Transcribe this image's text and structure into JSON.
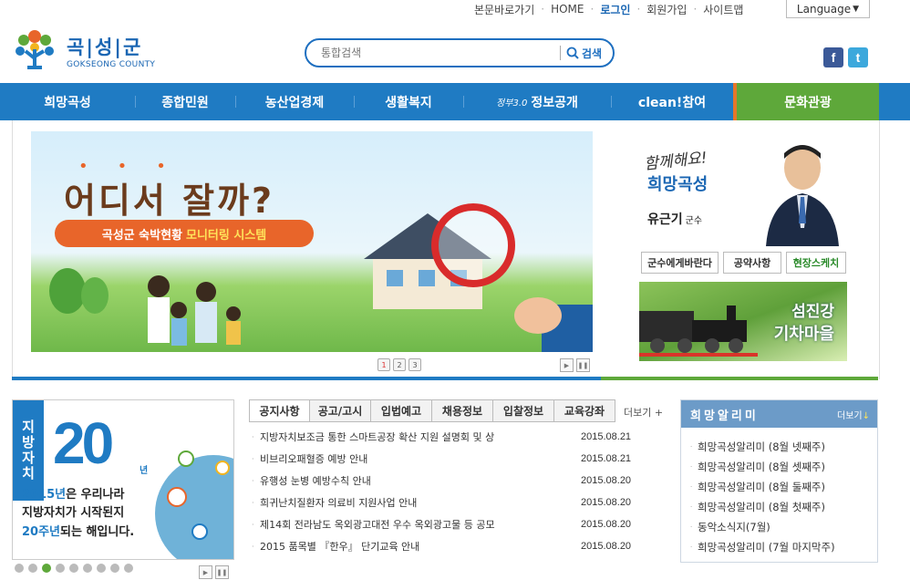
{
  "util": {
    "links": [
      "본문바로가기",
      "HOME",
      "로그인",
      "회원가입",
      "사이트맵"
    ],
    "language": "Language"
  },
  "logo": {
    "name_ko": "곡|성|군",
    "name_en": "GOKSEONG COUNTY"
  },
  "search": {
    "placeholder": "통합검색",
    "button_label": "검색"
  },
  "social": {
    "facebook": "f",
    "twitter": "t"
  },
  "nav": {
    "items": [
      "희망곡성",
      "종합민원",
      "농산업경제",
      "생활복지",
      "정보공개",
      "clean!참여",
      "문화관광"
    ],
    "gov30_prefix": "정부3.0"
  },
  "banner": {
    "headline": "어디서 잘까?",
    "pill_text": "곡성군 숙박현황",
    "pill_accent": "모니터링 시스템",
    "pages": [
      "1",
      "2",
      "3"
    ]
  },
  "governor": {
    "slogan1": "함께해요!",
    "slogan2": "희망곡성",
    "name": "유근기",
    "title": "군수",
    "buttons": [
      "군수에게바란다",
      "공약사항",
      "현장스케치"
    ]
  },
  "train": {
    "line1": "섬진강",
    "line2": "기차마을"
  },
  "promo": {
    "vertical": [
      "지",
      "방",
      "자",
      "치"
    ],
    "number": "20",
    "suffix": "년",
    "line1_accent": "2015년",
    "line1_rest": "은 우리나라",
    "line2": "지방자치가 시작된지",
    "line3_accent": "20주년",
    "line3_rest": "되는 해입니다."
  },
  "tabs": {
    "items": [
      "공지사항",
      "공고/고시",
      "입법예고",
      "채용정보",
      "입찰정보",
      "교육강좌"
    ],
    "more": "더보기 +"
  },
  "notices": [
    {
      "title": "지방자치보조금 통한 스마트공장 확산 지원 설명회 및 상",
      "date": "2015.08.21"
    },
    {
      "title": "비브리오패혈증 예방 안내",
      "date": "2015.08.21"
    },
    {
      "title": "유행성 눈병 예방수칙 안내",
      "date": "2015.08.20"
    },
    {
      "title": "희귀난치질환자 의료비 지원사업 안내",
      "date": "2015.08.20"
    },
    {
      "title": "제14회 전라남도 옥외광고대전 우수 옥외광고물 등 공모",
      "date": "2015.08.20"
    },
    {
      "title": "2015 품목별 『한우』 단기교육 안내",
      "date": "2015.08.20"
    }
  ],
  "alarm": {
    "title": "희망알리미",
    "more": "더보기",
    "items": [
      "희망곡성알리미 (8월 넷째주)",
      "희망곡성알리미 (8월 셋째주)",
      "희망곡성알리미 (8월 둘째주)",
      "희망곡성알리미 (8월 첫째주)",
      "동악소식지(7월)",
      "희망곡성알리미 (7월 마지막주)"
    ]
  }
}
